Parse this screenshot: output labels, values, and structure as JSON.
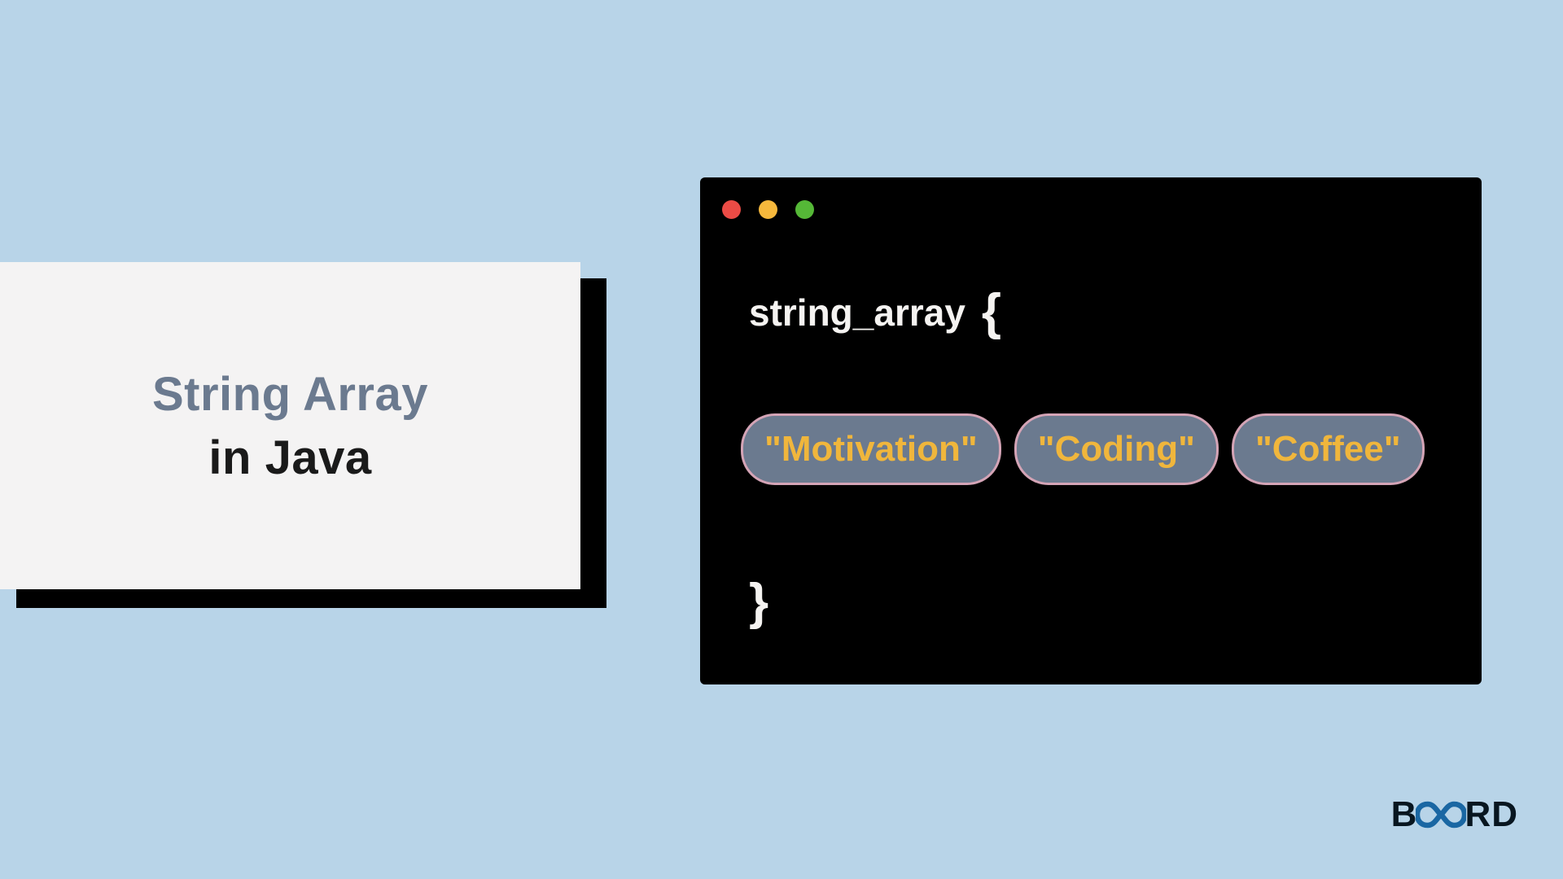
{
  "title": {
    "line1": "String Array",
    "line2": "in Java"
  },
  "code": {
    "identifier": "string_array",
    "open_brace": "{",
    "close_brace": "}",
    "items": [
      "\"Motivation\"",
      "\"Coding\"",
      "\"Coffee\""
    ]
  },
  "brand": {
    "prefix": "B",
    "suffix": "RD"
  },
  "colors": {
    "bg": "#b8d4e8",
    "card_bg": "#f4f3f3",
    "terminal_bg": "#000000",
    "pill_bg": "#6b7a8f",
    "pill_border": "#d4a4b6",
    "pill_text": "#f0b63c",
    "dot_red": "#eb4b45",
    "dot_yellow": "#f6b83c",
    "dot_green": "#55b837"
  }
}
